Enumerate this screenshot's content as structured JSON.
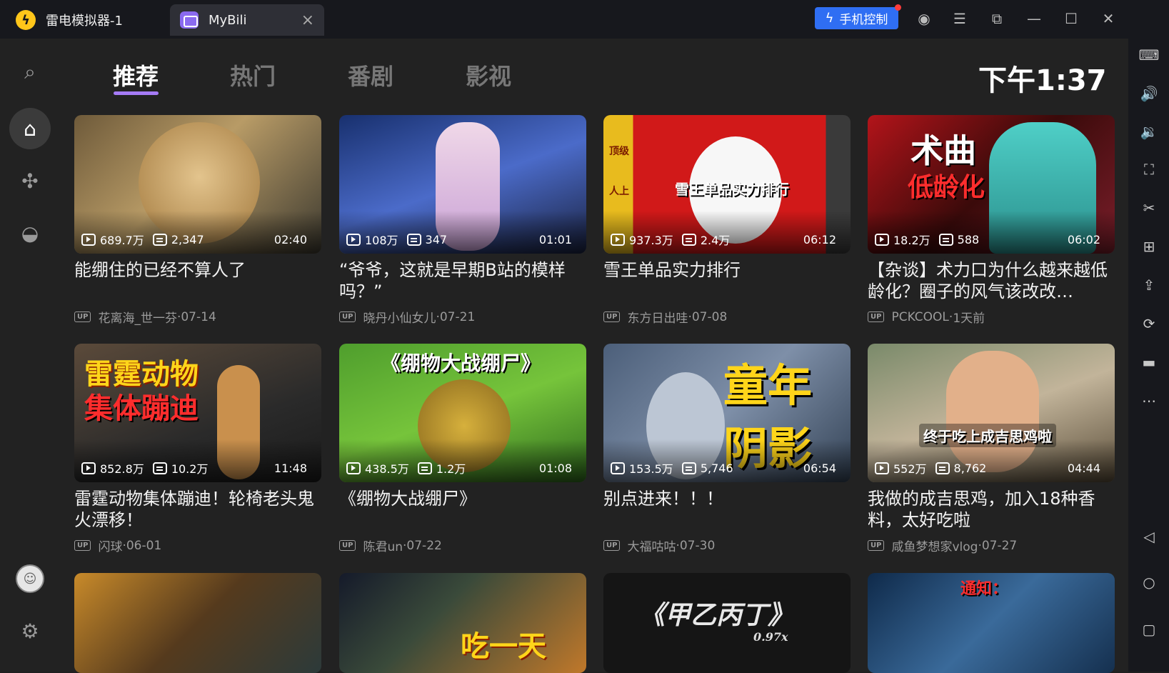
{
  "titlebar": {
    "tab1_label": "雷电模拟器-1",
    "tab2_label": "MyBili",
    "phone_control": "手机控制"
  },
  "header": {
    "tabs": [
      {
        "label": "推荐",
        "active": true
      },
      {
        "label": "热门",
        "active": false
      },
      {
        "label": "番剧",
        "active": false
      },
      {
        "label": "影视",
        "active": false
      }
    ],
    "clock": "下午1:37"
  },
  "videos": [
    {
      "title": "能绷住的已经不算人了",
      "views": "689.7万",
      "danmaku": "2,347",
      "duration": "02:40",
      "up": "花离海_世一芬",
      "date": "07-14"
    },
    {
      "title": "“爷爷，这就是早期B站的模样吗？”",
      "views": "108万",
      "danmaku": "347",
      "duration": "01:01",
      "up": "晓丹小仙女儿",
      "date": "07-21"
    },
    {
      "title": "雪王单品实力排行",
      "views": "937.3万",
      "danmaku": "2.4万",
      "duration": "06:12",
      "up": "东方日出哇",
      "date": "07-08"
    },
    {
      "title": "【杂谈】术力口为什么越来越低龄化？圈子的风气该改改…",
      "views": "18.2万",
      "danmaku": "588",
      "duration": "06:02",
      "up": "PCKCOOL",
      "date": "1天前"
    },
    {
      "title": "雷霆动物集体蹦迪！轮椅老头鬼火漂移！",
      "views": "852.8万",
      "danmaku": "10.2万",
      "duration": "11:48",
      "up": "闪球",
      "date": "06-01"
    },
    {
      "title": "《绷物大战绷尸》",
      "views": "438.5万",
      "danmaku": "1.2万",
      "duration": "01:08",
      "up": "陈君un",
      "date": "07-22"
    },
    {
      "title": "别点进来！！！",
      "views": "153.5万",
      "danmaku": "5,746",
      "duration": "06:54",
      "up": "大福咕咕",
      "date": "07-30"
    },
    {
      "title": "我做的成吉思鸡，加入18种香料，太好吃啦",
      "views": "552万",
      "danmaku": "8,762",
      "duration": "04:44",
      "up": "咸鱼梦想家vlog",
      "date": "07-27"
    }
  ],
  "thumb_texts": {
    "snow": "雪王单品实力排行",
    "snow_side1": "顶级",
    "snow_side2": "人上",
    "miku1": "术曲",
    "miku2": "低龄化",
    "thunder1": "雷霆动物",
    "thunder2": "集体蹦迪",
    "pvz": "《绷物大战绷尸》",
    "tom1": "童年",
    "tom2": "阴影",
    "chicken": "终于吃上成吉思鸡啦",
    "r3c": "《甲乙丙丁》",
    "r3c_sub": "0.97x",
    "r3b": "吃一天",
    "r3d": "通知："
  },
  "up_badge": "UP",
  "separator": " · "
}
